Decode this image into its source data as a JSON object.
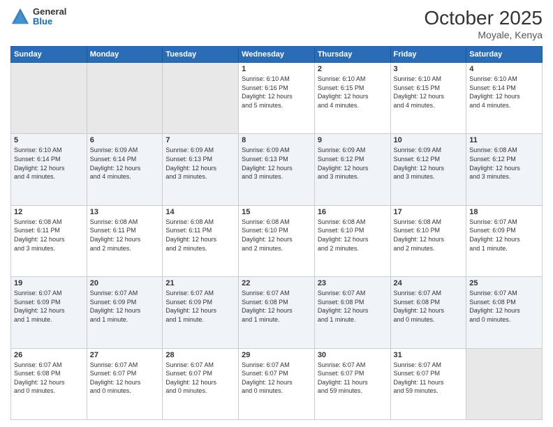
{
  "header": {
    "logo_general": "General",
    "logo_blue": "Blue",
    "month_title": "October 2025",
    "location": "Moyale, Kenya"
  },
  "days_of_week": [
    "Sunday",
    "Monday",
    "Tuesday",
    "Wednesday",
    "Thursday",
    "Friday",
    "Saturday"
  ],
  "weeks": [
    [
      {
        "day": "",
        "info": ""
      },
      {
        "day": "",
        "info": ""
      },
      {
        "day": "",
        "info": ""
      },
      {
        "day": "1",
        "info": "Sunrise: 6:10 AM\nSunset: 6:16 PM\nDaylight: 12 hours\nand 5 minutes."
      },
      {
        "day": "2",
        "info": "Sunrise: 6:10 AM\nSunset: 6:15 PM\nDaylight: 12 hours\nand 4 minutes."
      },
      {
        "day": "3",
        "info": "Sunrise: 6:10 AM\nSunset: 6:15 PM\nDaylight: 12 hours\nand 4 minutes."
      },
      {
        "day": "4",
        "info": "Sunrise: 6:10 AM\nSunset: 6:14 PM\nDaylight: 12 hours\nand 4 minutes."
      }
    ],
    [
      {
        "day": "5",
        "info": "Sunrise: 6:10 AM\nSunset: 6:14 PM\nDaylight: 12 hours\nand 4 minutes."
      },
      {
        "day": "6",
        "info": "Sunrise: 6:09 AM\nSunset: 6:14 PM\nDaylight: 12 hours\nand 4 minutes."
      },
      {
        "day": "7",
        "info": "Sunrise: 6:09 AM\nSunset: 6:13 PM\nDaylight: 12 hours\nand 3 minutes."
      },
      {
        "day": "8",
        "info": "Sunrise: 6:09 AM\nSunset: 6:13 PM\nDaylight: 12 hours\nand 3 minutes."
      },
      {
        "day": "9",
        "info": "Sunrise: 6:09 AM\nSunset: 6:12 PM\nDaylight: 12 hours\nand 3 minutes."
      },
      {
        "day": "10",
        "info": "Sunrise: 6:09 AM\nSunset: 6:12 PM\nDaylight: 12 hours\nand 3 minutes."
      },
      {
        "day": "11",
        "info": "Sunrise: 6:08 AM\nSunset: 6:12 PM\nDaylight: 12 hours\nand 3 minutes."
      }
    ],
    [
      {
        "day": "12",
        "info": "Sunrise: 6:08 AM\nSunset: 6:11 PM\nDaylight: 12 hours\nand 3 minutes."
      },
      {
        "day": "13",
        "info": "Sunrise: 6:08 AM\nSunset: 6:11 PM\nDaylight: 12 hours\nand 2 minutes."
      },
      {
        "day": "14",
        "info": "Sunrise: 6:08 AM\nSunset: 6:11 PM\nDaylight: 12 hours\nand 2 minutes."
      },
      {
        "day": "15",
        "info": "Sunrise: 6:08 AM\nSunset: 6:10 PM\nDaylight: 12 hours\nand 2 minutes."
      },
      {
        "day": "16",
        "info": "Sunrise: 6:08 AM\nSunset: 6:10 PM\nDaylight: 12 hours\nand 2 minutes."
      },
      {
        "day": "17",
        "info": "Sunrise: 6:08 AM\nSunset: 6:10 PM\nDaylight: 12 hours\nand 2 minutes."
      },
      {
        "day": "18",
        "info": "Sunrise: 6:07 AM\nSunset: 6:09 PM\nDaylight: 12 hours\nand 1 minute."
      }
    ],
    [
      {
        "day": "19",
        "info": "Sunrise: 6:07 AM\nSunset: 6:09 PM\nDaylight: 12 hours\nand 1 minute."
      },
      {
        "day": "20",
        "info": "Sunrise: 6:07 AM\nSunset: 6:09 PM\nDaylight: 12 hours\nand 1 minute."
      },
      {
        "day": "21",
        "info": "Sunrise: 6:07 AM\nSunset: 6:09 PM\nDaylight: 12 hours\nand 1 minute."
      },
      {
        "day": "22",
        "info": "Sunrise: 6:07 AM\nSunset: 6:08 PM\nDaylight: 12 hours\nand 1 minute."
      },
      {
        "day": "23",
        "info": "Sunrise: 6:07 AM\nSunset: 6:08 PM\nDaylight: 12 hours\nand 1 minute."
      },
      {
        "day": "24",
        "info": "Sunrise: 6:07 AM\nSunset: 6:08 PM\nDaylight: 12 hours\nand 0 minutes."
      },
      {
        "day": "25",
        "info": "Sunrise: 6:07 AM\nSunset: 6:08 PM\nDaylight: 12 hours\nand 0 minutes."
      }
    ],
    [
      {
        "day": "26",
        "info": "Sunrise: 6:07 AM\nSunset: 6:08 PM\nDaylight: 12 hours\nand 0 minutes."
      },
      {
        "day": "27",
        "info": "Sunrise: 6:07 AM\nSunset: 6:07 PM\nDaylight: 12 hours\nand 0 minutes."
      },
      {
        "day": "28",
        "info": "Sunrise: 6:07 AM\nSunset: 6:07 PM\nDaylight: 12 hours\nand 0 minutes."
      },
      {
        "day": "29",
        "info": "Sunrise: 6:07 AM\nSunset: 6:07 PM\nDaylight: 12 hours\nand 0 minutes."
      },
      {
        "day": "30",
        "info": "Sunrise: 6:07 AM\nSunset: 6:07 PM\nDaylight: 11 hours\nand 59 minutes."
      },
      {
        "day": "31",
        "info": "Sunrise: 6:07 AM\nSunset: 6:07 PM\nDaylight: 11 hours\nand 59 minutes."
      },
      {
        "day": "",
        "info": ""
      }
    ]
  ]
}
